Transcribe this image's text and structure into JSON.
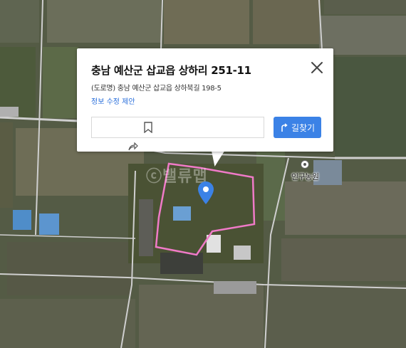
{
  "popup": {
    "title": "충남 예산군 삽교읍 상하리 251-11",
    "road_address": "(도로명) 충남 예산군 삽교읍 상하북길 198-5",
    "edit_link": "정보 수정 제안",
    "directions_label": "길찾기"
  },
  "map": {
    "poi_label": "인구농원",
    "watermark": "ⓒ밸류맵",
    "boundary_color": "#f07ac8",
    "marker_color": "#3b82e6"
  },
  "icons": [
    "close-icon",
    "bookmark-icon",
    "share-icon",
    "directions-icon",
    "location-pin-icon"
  ]
}
